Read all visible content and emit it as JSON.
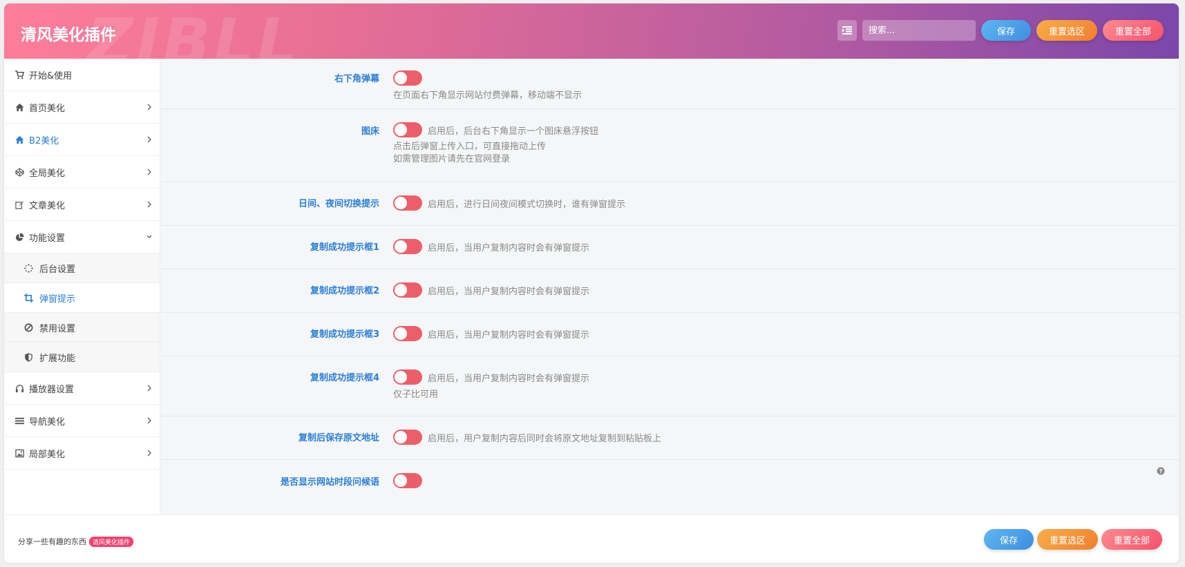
{
  "header": {
    "title": "清风美化插件",
    "watermark": "ZIBLL",
    "search_placeholder": "搜索...",
    "save_label": "保存",
    "reset_section_label": "重置选区",
    "reset_all_label": "重置全部"
  },
  "sidebar": {
    "items": [
      {
        "label": "开始&使用",
        "icon": "cart-icon"
      },
      {
        "label": "首页美化",
        "icon": "home-icon"
      },
      {
        "label": "B2美化",
        "icon": "home-icon"
      },
      {
        "label": "全局美化",
        "icon": "codepen-icon"
      },
      {
        "label": "文章美化",
        "icon": "edit-icon"
      },
      {
        "label": "功能设置",
        "icon": "pie-chart-icon"
      },
      {
        "label": "播放器设置",
        "icon": "headphones-icon"
      },
      {
        "label": "导航美化",
        "icon": "list-icon"
      },
      {
        "label": "局部美化",
        "icon": "image-icon"
      }
    ],
    "sub_items": [
      {
        "label": "后台设置",
        "icon": "spinner-icon"
      },
      {
        "label": "弹窗提示",
        "icon": "crop-icon"
      },
      {
        "label": "禁用设置",
        "icon": "ban-icon"
      },
      {
        "label": "扩展功能",
        "icon": "shield-icon"
      }
    ]
  },
  "settings": [
    {
      "label": "右下角弹幕",
      "inline": "",
      "desc": [
        "在页面右下角显示网站付费弹幕，移动端不显示"
      ]
    },
    {
      "label": "图床",
      "inline": "启用后，后台右下角显示一个图床悬浮按钮",
      "desc": [
        "点击后弹窗上传入口，可直接拖动上传",
        "如需管理图片请先在官网登录"
      ]
    },
    {
      "label": "日间、夜间切换提示",
      "inline": "启用后，进行日间夜间模式切换时，谁有弹窗提示",
      "desc": []
    },
    {
      "label": "复制成功提示框1",
      "inline": "启用后，当用户复制内容时会有弹窗提示",
      "desc": []
    },
    {
      "label": "复制成功提示框2",
      "inline": "启用后，当用户复制内容时会有弹窗提示",
      "desc": []
    },
    {
      "label": "复制成功提示框3",
      "inline": "启用后，当用户复制内容时会有弹窗提示",
      "desc": []
    },
    {
      "label": "复制成功提示框4",
      "inline": "启用后，当用户复制内容时会有弹窗提示",
      "desc": [
        "仅子比可用"
      ]
    },
    {
      "label": "复制后保存原文地址",
      "inline": "启用后，用户复制内容后同时会将原文地址复制到粘贴板上",
      "desc": []
    },
    {
      "label": "是否显示网站时段问候语",
      "inline": "",
      "desc": []
    }
  ],
  "footer": {
    "text": "分享一些有趣的东西",
    "tag": "清风美化插件",
    "save_label": "保存",
    "reset_section_label": "重置选区",
    "reset_all_label": "重置全部"
  },
  "colors": {
    "accent_blue": "#2a7fd8",
    "toggle_off": "#ec5f6a",
    "header_start": "#fd7e98",
    "header_end": "#7a47aa"
  }
}
